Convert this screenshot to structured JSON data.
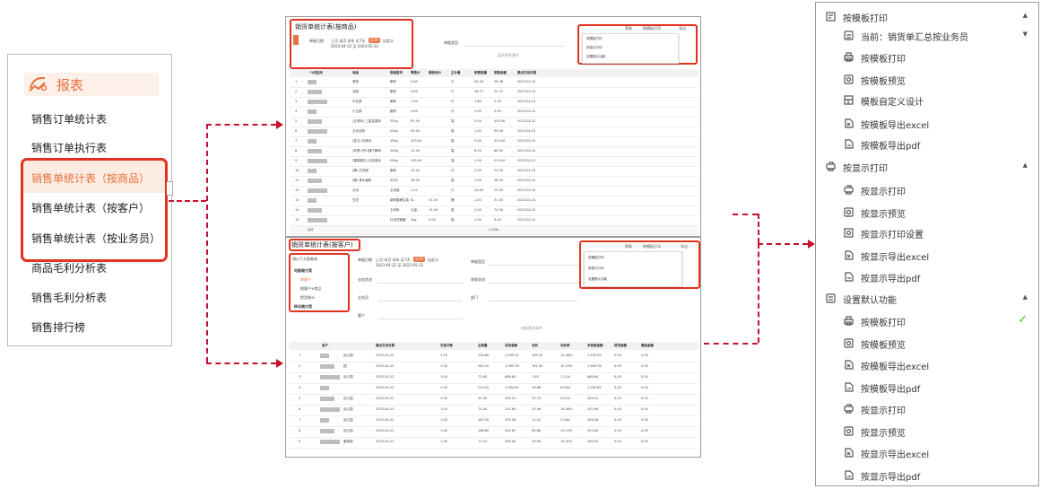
{
  "left_menu": {
    "title": "报表",
    "items": [
      "销售订单统计表",
      "销售订单执行表",
      "销售单统计表（按商品）",
      "销售单统计表（按客户）",
      "销售单统计表（按业务员）",
      "商品毛利分析表",
      "销售毛利分析表",
      "销售排行榜"
    ]
  },
  "shot_top": {
    "title": "销货单统计表(按商品)",
    "date_label": "单据日期",
    "date_quick": "上月 本月 本年 近7天",
    "date_active": "近30",
    "date_custom": "自定义",
    "date_range": "2023-04-22 至 2023-05-22",
    "bill_type_label": "单据类型",
    "expand": "展开更多条件",
    "toolbar": {
      "help": "帮助",
      "print": "按模板打印",
      "export": "导出"
    },
    "menu": [
      "按模板打印",
      "按显示打印",
      "设置默认功能"
    ],
    "columns": [
      "",
      "*1供应商",
      "商品",
      "规格型号",
      "零售价",
      "最新进价",
      "主计量",
      "销售数量",
      "销售金额",
      "最后交易日期"
    ],
    "rows": [
      [
        "1",
        "",
        "菠菜",
        "散称",
        "0.60",
        "",
        "斤",
        "40.40",
        "36.36",
        "2023-04-22"
      ],
      [
        "2",
        "",
        "油菜",
        "散称",
        "0.85",
        "",
        "斤",
        "26.72",
        "22.72",
        "2023-04-22"
      ],
      [
        "3",
        "",
        "叶生菜",
        "散称",
        "1.00",
        "",
        "斤",
        "1.80",
        "2.16",
        "2023-04-22"
      ],
      [
        "4",
        "",
        "小白菜",
        "散称",
        "0.80",
        "",
        "斤",
        "3.00",
        "2.55",
        "2023-04-22"
      ],
      [
        "5",
        "",
        "(五得利) 三星富强粉",
        "25kg",
        "87.00",
        "",
        "袋",
        "5.00",
        "435.00",
        "2023-04-22"
      ],
      [
        "6",
        "",
        "玉米淀粉",
        "25kg",
        "95.00",
        "",
        "袋",
        "1.00",
        "95.00",
        "2023-04-22"
      ],
      [
        "7",
        "",
        "(佐丸) 珍珠米",
        "25kg",
        "103.00",
        "",
        "袋",
        "5.00",
        "515.00",
        "2023-04-22"
      ],
      [
        "8",
        "",
        "(安德) 好口福干酵母",
        "500g",
        "11.00",
        "",
        "袋",
        "8.00",
        "88.00",
        "2023-04-22"
      ],
      [
        "9",
        "",
        "(喜喜喜花) 长粒香米",
        "25kg",
        "105.00",
        "",
        "袋",
        "2.00",
        "210.00",
        "2023-04-22"
      ],
      [
        "10",
        "",
        "(腾) 白芝麻",
        "散称",
        "12.00",
        "",
        "斤",
        "2.00",
        "24.00",
        "2023-04-22"
      ],
      [
        "11",
        "",
        "(腾) 黑木薯粉",
        "约3斤",
        "38.00",
        "",
        "袋",
        "1.00",
        "38.00",
        "2023-04-22"
      ],
      [
        "12",
        "",
        "大米",
        "玉米面",
        "2.20",
        "",
        "斤",
        "10.00",
        "22.00",
        "2023-04-22"
      ],
      [
        "13",
        "",
        "豆花",
        "新鲜酸辣生抽",
        "5L",
        "31.00",
        "桶",
        "1.00",
        "31.00",
        "2023-04-22"
      ],
      [
        "14",
        "",
        "",
        "玉米粉",
        "计量...",
        "74.00",
        "袋",
        "1.00",
        "74.00",
        "2023-04-22"
      ],
      [
        "15",
        "",
        "",
        "红油豆瓣酱",
        "1kg",
        "9.00",
        "袋",
        "1.00",
        "9.00",
        "2023-04-22"
      ]
    ],
    "total_label": "合计",
    "total_value": "1,408..."
  },
  "shot_bottom": {
    "title": "销货单统计表(按客户)",
    "scheme_label": "请以下方案查询",
    "scheme_groups": [
      "电脑端方案",
      "移动端方案"
    ],
    "scheme_items": [
      "按客户",
      "按客户+商品",
      "提货统计"
    ],
    "date_label": "单据日期",
    "date_quick": "上月 本月 本年 近7天",
    "date_active": "近30",
    "date_custom": "自定义",
    "date_range": "2023-04-22 至 2023-05-22",
    "filters": [
      "单据类型",
      "业务状态",
      "收款状态",
      "业务员",
      "部门",
      "客户"
    ],
    "expand": "收起更多条件",
    "toolbar": {
      "help": "帮助",
      "print": "按模板打印",
      "export": "导出"
    },
    "menu": [
      "按模板打印",
      "按显示打印",
      "设置默认功能"
    ],
    "columns": [
      "",
      "客户",
      "最后交易日期",
      "交易次数",
      "主数量",
      "实际金额",
      "毛利",
      "毛利率",
      "未收款金额",
      "退货金额",
      "赠品金额"
    ],
    "rows": [
      [
        "1",
        "幼儿园",
        "2023-04-22",
        "1.00",
        "148.80",
        "1,492.52",
        "185.23",
        "12.48%",
        "1,492.52",
        "0.00",
        "0.00"
      ],
      [
        "2",
        "园",
        "2023-04-22",
        "1.00",
        "260.10",
        "1,583.78",
        "161.30",
        "10.19%",
        "1,583.78",
        "0.00",
        "0.00"
      ],
      [
        "3",
        "幼儿园",
        "2023-04-22",
        "1.00",
        "72.80",
        "669.84",
        "7.45",
        "1.11%",
        "669.84",
        "0.00",
        "0.00"
      ],
      [
        "4",
        "",
        "2023-04-22",
        "1.00",
        "210.20",
        "1,262.82",
        "76.88",
        "6.09%",
        "1,262.82",
        "0.00",
        "0.00"
      ],
      [
        "5",
        "幼儿园",
        "2023-04-22",
        "1.00",
        "52.40",
        "263.51",
        "23.73",
        "9.01%",
        "263.51",
        "0.00",
        "0.00"
      ],
      [
        "6",
        "幼儿园",
        "2023-04-22",
        "1.00",
        "72.40",
        "252.64",
        "25.46",
        "10.08%",
        "252.64",
        "0.00",
        "0.00"
      ],
      [
        "7",
        "幼儿园",
        "2023-04-22",
        "1.00",
        "182.50",
        "305.58",
        "11.22",
        "3.16%",
        "305.58",
        "0.00",
        "0.00"
      ],
      [
        "8",
        "幼儿园",
        "2023-04-22",
        "1.00",
        "188.80",
        "502.82",
        "65.86",
        "13.10%",
        "502.82",
        "0.00",
        "0.00"
      ],
      [
        "9",
        "董事园",
        "2023-04-22",
        "1.00",
        "71.10",
        "269.00",
        "39.06",
        "14.52%",
        "269.00",
        "0.00",
        "0.00"
      ]
    ]
  },
  "right_menu": {
    "rows": [
      {
        "label": "按模板打印",
        "icon": "template-print-icon",
        "caret": "▲",
        "indent": 0
      },
      {
        "label": "当前：销货单汇总按业务员",
        "icon": "template-icon",
        "caret": "▼",
        "indent": 1
      },
      {
        "label": "按模板打印",
        "icon": "printer-icon",
        "caret": "",
        "indent": 1
      },
      {
        "label": "按模板预览",
        "icon": "preview-icon",
        "caret": "",
        "indent": 1
      },
      {
        "label": "模板自定义设计",
        "icon": "design-icon",
        "caret": "",
        "indent": 1
      },
      {
        "label": "按模板导出excel",
        "icon": "export-excel-icon",
        "caret": "",
        "indent": 1
      },
      {
        "label": "按模板导出pdf",
        "icon": "export-pdf-icon",
        "caret": "",
        "indent": 1
      },
      {
        "label": "按显示打印",
        "icon": "display-print-icon",
        "caret": "▲",
        "indent": 0
      },
      {
        "label": "按显示打印",
        "icon": "display-print-icon",
        "caret": "",
        "indent": 1
      },
      {
        "label": "按显示预览",
        "icon": "preview-icon",
        "caret": "",
        "indent": 1
      },
      {
        "label": "按显示打印设置",
        "icon": "print-settings-icon",
        "caret": "",
        "indent": 1
      },
      {
        "label": "按显示导出excel",
        "icon": "export-excel-icon",
        "caret": "",
        "indent": 1
      },
      {
        "label": "按显示导出pdf",
        "icon": "export-pdf-icon",
        "caret": "",
        "indent": 1
      },
      {
        "label": "设置默认功能",
        "icon": "default-settings-icon",
        "caret": "▲",
        "indent": 0
      },
      {
        "label": "按模板打印",
        "icon": "printer-icon",
        "caret": "✓",
        "indent": 1
      },
      {
        "label": "按模板预览",
        "icon": "preview-icon",
        "caret": "",
        "indent": 1
      },
      {
        "label": "按模板导出excel",
        "icon": "export-excel-icon",
        "caret": "",
        "indent": 1
      },
      {
        "label": "按模板导出pdf",
        "icon": "export-pdf-icon",
        "caret": "",
        "indent": 1
      },
      {
        "label": "按显示打印",
        "icon": "display-print-icon",
        "caret": "",
        "indent": 1
      },
      {
        "label": "按显示预览",
        "icon": "preview-icon",
        "caret": "",
        "indent": 1
      },
      {
        "label": "按显示导出excel",
        "icon": "export-excel-icon",
        "caret": "",
        "indent": 1
      },
      {
        "label": "按显示导出pdf",
        "icon": "export-pdf-icon",
        "caret": "",
        "indent": 1
      }
    ]
  },
  "colors": {
    "accent": "#e8713c",
    "highlight": "#e1321f",
    "arrow": "#c8102e",
    "check": "#52c41a"
  }
}
